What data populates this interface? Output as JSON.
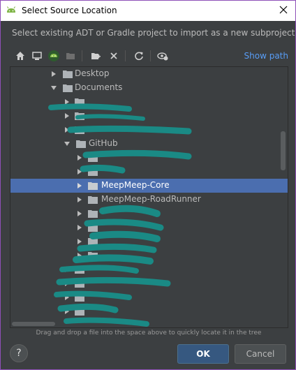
{
  "window": {
    "title": "Select Source Location"
  },
  "description": "Select existing ADT or Gradle project to import as a new subproject",
  "toolbar": {
    "icons": [
      "home-icon",
      "desktop-icon",
      "android-project-icon",
      "module-folder-icon",
      "new-folder-icon",
      "delete-icon",
      "refresh-icon",
      "show-hidden-icon"
    ],
    "show_path_label": "Show path"
  },
  "tree": {
    "items": [
      {
        "label": "Desktop",
        "expanded": false,
        "depth": 1
      },
      {
        "label": "Documents",
        "expanded": true,
        "depth": 1
      },
      {
        "label": "GitHub",
        "expanded": true,
        "depth": 2
      },
      {
        "label": "MeepMeep-Core",
        "expanded": false,
        "depth": 3,
        "selected": true
      },
      {
        "label": "MeepMeep-RoadRunner",
        "expanded": false,
        "depth": 3
      }
    ]
  },
  "hint": "Drag and drop a file into the space above to quickly locate it in the tree",
  "buttons": {
    "ok": "OK",
    "cancel": "Cancel",
    "help": "?"
  },
  "colors": {
    "selection": "#4b6eaf",
    "scribble": "#1a8a85",
    "link": "#589df6",
    "border": "#8e4fb8"
  }
}
